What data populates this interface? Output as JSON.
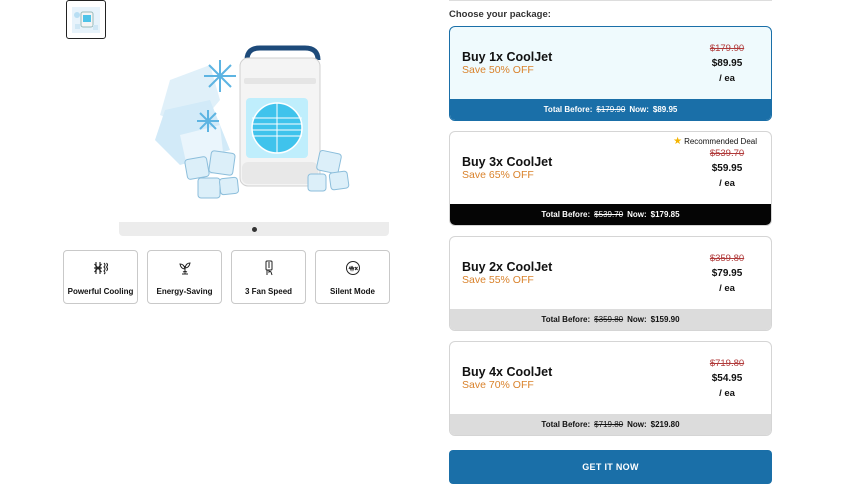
{
  "gallery": {
    "thumbnail_icon": "product-thumbnail",
    "slide_indicator": "slider-dot"
  },
  "features": [
    {
      "icon": "snowflake-icon",
      "label": "Powerful Cooling"
    },
    {
      "icon": "leaf-icon",
      "label": "Energy-Saving"
    },
    {
      "icon": "remote-icon",
      "label": "3 Fan Speed"
    },
    {
      "icon": "quiet-icon",
      "label": "Silent Mode"
    }
  ],
  "packages": {
    "heading": "Choose your package:",
    "items": [
      {
        "title": "Buy 1x CoolJet",
        "save": "Save 50% OFF",
        "old_price": "$179.90",
        "price": "$89.95",
        "unit": "/ ea",
        "bar_before_label": "Total Before:",
        "bar_before": "$179.90",
        "bar_now_label": "Now:",
        "bar_now": "$89.95",
        "badge": ""
      },
      {
        "title": "Buy 3x CoolJet",
        "save": "Save 65% OFF",
        "old_price": "$539.70",
        "price": "$59.95",
        "unit": "/ ea",
        "bar_before_label": "Total Before:",
        "bar_before": "$539.70",
        "bar_now_label": "Now:",
        "bar_now": "$179.85",
        "badge": "Recommended Deal"
      },
      {
        "title": "Buy 2x CoolJet",
        "save": "Save 55% OFF",
        "old_price": "$359.80",
        "price": "$79.95",
        "unit": "/ ea",
        "bar_before_label": "Total Before:",
        "bar_before": "$359.80",
        "bar_now_label": "Now:",
        "bar_now": "$159.90",
        "badge": ""
      },
      {
        "title": "Buy 4x CoolJet",
        "save": "Save 70% OFF",
        "old_price": "$719.80",
        "price": "$54.95",
        "unit": "/ ea",
        "bar_before_label": "Total Before:",
        "bar_before": "$719.80",
        "bar_now_label": "Now:",
        "bar_now": "$219.80",
        "badge": ""
      }
    ]
  },
  "cta": {
    "label": "GET IT NOW"
  },
  "colors": {
    "primary": "#1a6fa8",
    "save": "#d9822b",
    "strike": "#b03a3a",
    "star": "#f4b400"
  }
}
